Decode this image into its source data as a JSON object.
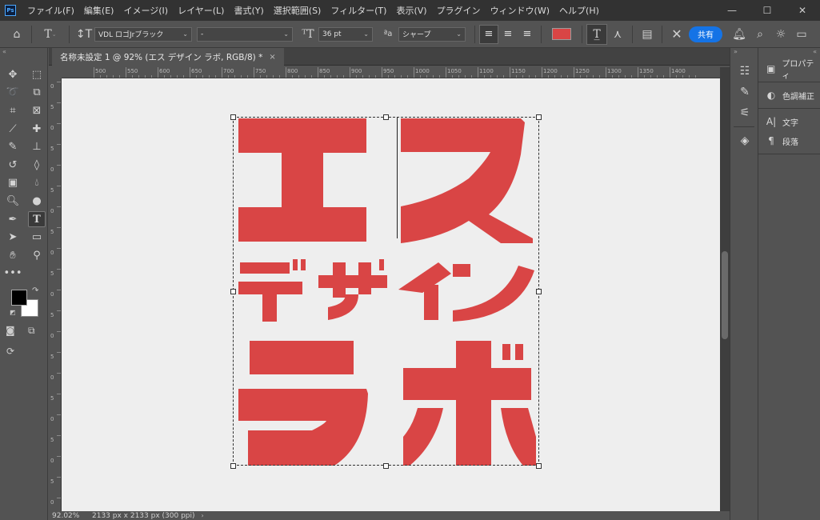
{
  "app": {
    "logo_text": "Ps"
  },
  "menu": [
    "ファイル(F)",
    "編集(E)",
    "イメージ(I)",
    "レイヤー(L)",
    "書式(Y)",
    "選択範囲(S)",
    "フィルター(T)",
    "表示(V)",
    "プラグイン",
    "ウィンドウ(W)",
    "ヘルプ(H)"
  ],
  "window_controls": {
    "minimize": "—",
    "maximize": "☐",
    "close": "✕"
  },
  "options": {
    "font_family": "VDL ロゴJrブラック",
    "font_style": "-",
    "font_size": "36 pt",
    "aa_label": "ªa",
    "antialias": "シャープ",
    "text_color": "#d94545",
    "share_label": "共有"
  },
  "document": {
    "tab_title": "名称未設定 1 @ 92% (エス デザイン ラボ, RGB/8) *",
    "close_label": "×",
    "zoom": "92.02%",
    "doc_info": "2133 px x 2133 px (300 ppi)"
  },
  "ruler": {
    "h_labels": [
      "500",
      "550",
      "600",
      "650",
      "700",
      "750",
      "800",
      "850",
      "900",
      "950",
      "1000",
      "1050",
      "1100",
      "1150",
      "1200",
      "1250",
      "1300",
      "1350",
      "1400"
    ],
    "v_labels": [
      "0",
      "5",
      "0",
      "5",
      "0",
      "5",
      "0",
      "5",
      "0",
      "5",
      "0",
      "5",
      "0",
      "5",
      "0",
      "5",
      "0",
      "5",
      "0",
      "5",
      "0"
    ]
  },
  "panels": {
    "group1": [
      {
        "icon": "properties-icon",
        "label": "プロパティ"
      }
    ],
    "group2": [
      {
        "icon": "adjustments-icon",
        "label": "色調補正"
      }
    ],
    "group3": [
      {
        "icon": "character-icon",
        "label": "文字"
      },
      {
        "icon": "paragraph-icon",
        "label": "段落"
      }
    ]
  },
  "artwork": {
    "color": "#d94545",
    "text": "エス デザイン ラボ"
  }
}
